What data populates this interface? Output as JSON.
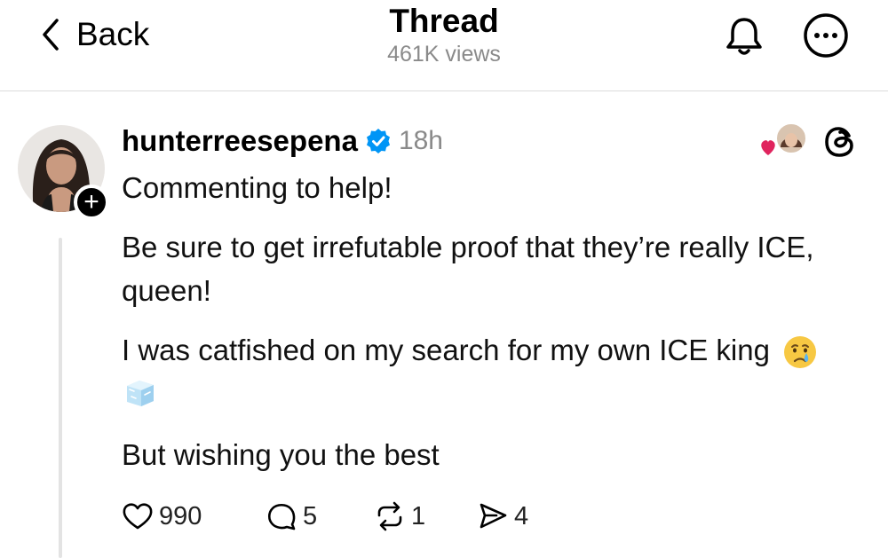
{
  "header": {
    "back_label": "Back",
    "title": "Thread",
    "views": "461K views"
  },
  "post": {
    "username": "hunterreesepena",
    "time": "18h",
    "paragraphs": [
      "Commenting to help!",
      "Be sure to get irrefutable proof that they’re really ICE,",
      "queen!",
      "I was catfished on my search for my own ICE king",
      "But wishing you the best"
    ],
    "emojis": [
      "crying-face-emoji",
      "ice-cube-emoji"
    ],
    "likes": "990",
    "replies": "5",
    "reposts": "1",
    "shares": "4"
  },
  "icons": {
    "back": "chevron-left-icon",
    "bell": "bell-icon",
    "more": "more-icon",
    "verified": "verified-badge-icon",
    "threads": "threads-logo-icon",
    "like": "heart-icon",
    "reply": "comment-icon",
    "repost": "repost-icon",
    "share": "share-icon"
  },
  "colors": {
    "accent_verified": "#0095f6",
    "liked_heart": "#e0245e",
    "muted_text": "#8a8a8a"
  }
}
